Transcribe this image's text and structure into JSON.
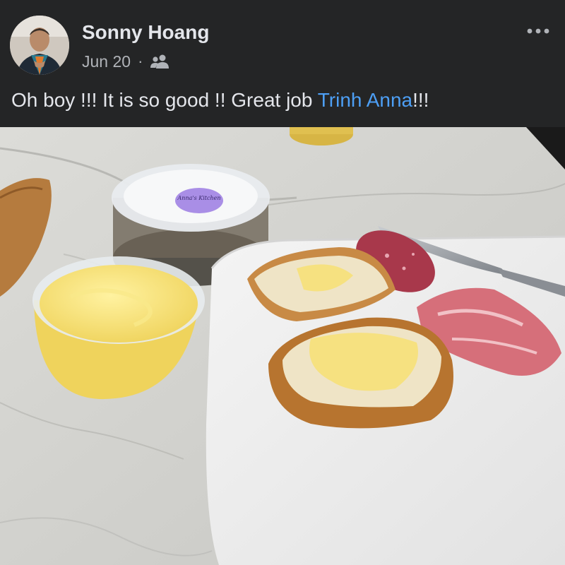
{
  "post": {
    "author": "Sonny Hoang",
    "date": "Jun 20",
    "separator": "·",
    "audience_icon": "friends-icon",
    "more_icon": "more-options-icon",
    "text_before": "Oh boy !!! It is so good !! Great job ",
    "mention": "Trinh Anna",
    "text_after": "!!!"
  },
  "photo": {
    "subject": "food-photo",
    "container_label": "Anna's Kitchen"
  },
  "colors": {
    "background": "#242526",
    "text": "#e4e6eb",
    "secondary_text": "#b0b3b8",
    "mention": "#4d9ff5"
  }
}
